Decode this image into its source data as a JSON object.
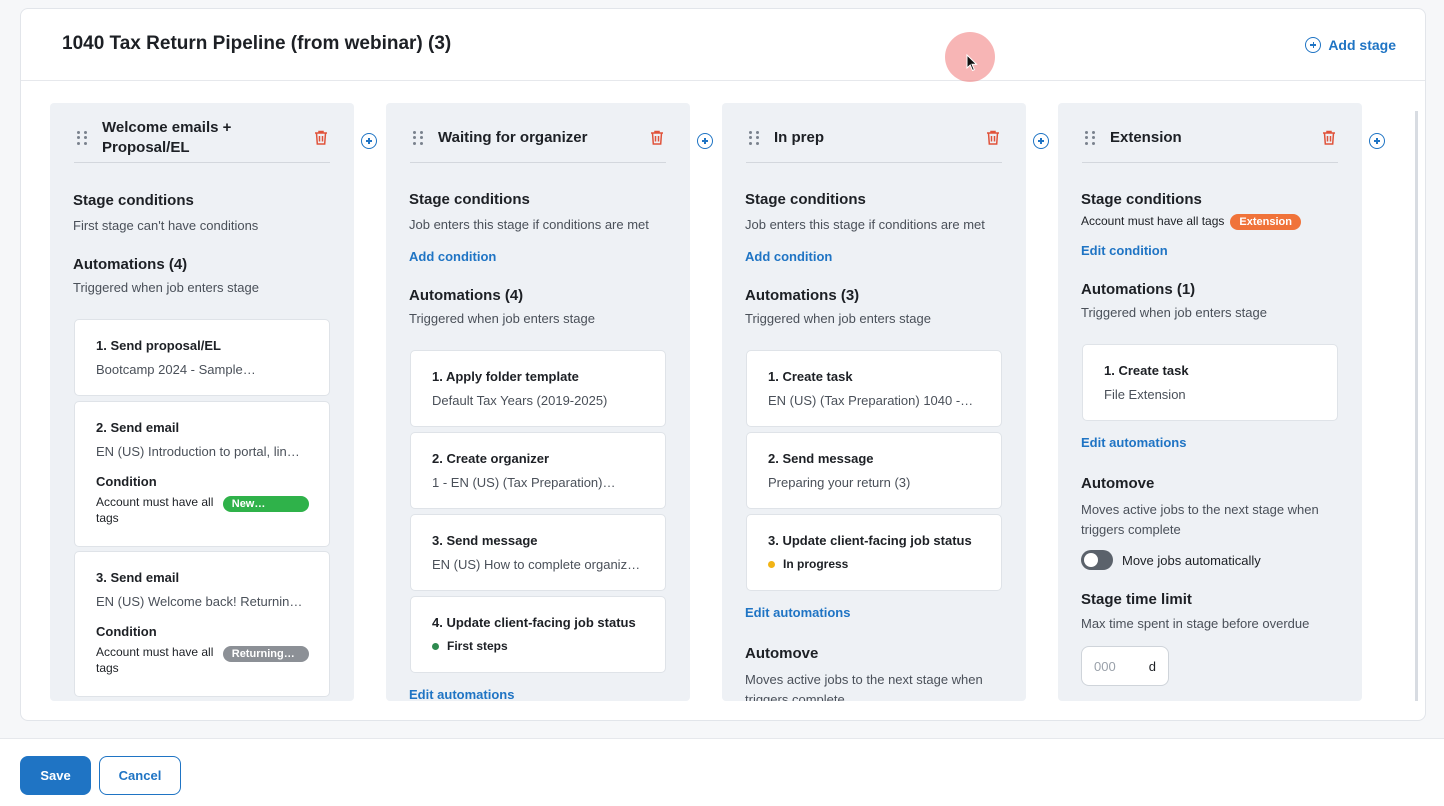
{
  "pipeline": {
    "title": "1040 Tax Return Pipeline (from webinar) (3)",
    "add_stage_label": "Add stage"
  },
  "stages": [
    {
      "name": "Welcome emails + Proposal/EL",
      "conditions_title": "Stage conditions",
      "conditions_sub": "First stage can't have conditions",
      "automations_title": "Automations (4)",
      "automations_sub": "Triggered when job enters stage",
      "cards": [
        {
          "title": "1. Send proposal/EL",
          "sub": "Bootcamp 2024 - Sample…"
        },
        {
          "title": "2. Send email",
          "sub": "EN (US) Introduction to portal, lin…",
          "condition_label": "Condition",
          "condition_text": "Account must have all tags",
          "condition_tag": "New…",
          "condition_tag_color": "#2fb24a"
        },
        {
          "title": "3. Send email",
          "sub": "EN (US) Welcome back! Returning…",
          "condition_label": "Condition",
          "condition_text": "Account must have all tags",
          "condition_tag": "Returning…",
          "condition_tag_color": "#8c9096"
        }
      ]
    },
    {
      "name": "Waiting for organizer",
      "conditions_title": "Stage conditions",
      "conditions_sub": "Job enters this stage if conditions are met",
      "add_condition": "Add condition",
      "automations_title": "Automations (4)",
      "automations_sub": "Triggered when job enters stage",
      "cards": [
        {
          "title": "1. Apply folder template",
          "sub": "Default Tax Years (2019-2025)"
        },
        {
          "title": "2. Create organizer",
          "sub": "1 - EN (US) (Tax Preparation)…"
        },
        {
          "title": "3. Send message",
          "sub": "EN (US) How to complete organize…"
        },
        {
          "title": "4. Update client-facing job status",
          "status": "First steps",
          "status_color": "#2e8a4f"
        }
      ],
      "edit_automations": "Edit automations"
    },
    {
      "name": "In prep",
      "conditions_title": "Stage conditions",
      "conditions_sub": "Job enters this stage if conditions are met",
      "add_condition": "Add condition",
      "automations_title": "Automations (3)",
      "automations_sub": "Triggered when job enters stage",
      "cards": [
        {
          "title": "1. Create task",
          "sub": "EN (US) (Tax Preparation) 1040 -…"
        },
        {
          "title": "2. Send message",
          "sub": "Preparing your return (3)"
        },
        {
          "title": "3. Update client-facing job status",
          "status": "In progress",
          "status_color": "#f2b416"
        }
      ],
      "edit_automations": "Edit automations",
      "automove_title": "Automove",
      "automove_sub": "Moves active jobs to the next stage when triggers complete"
    },
    {
      "name": "Extension",
      "conditions_title": "Stage conditions",
      "conditions_text": "Account must have all tags",
      "conditions_tag": "Extension",
      "edit_condition": "Edit condition",
      "automations_title": "Automations (1)",
      "automations_sub": "Triggered when job enters stage",
      "cards": [
        {
          "title": "1. Create task",
          "sub": "File Extension"
        }
      ],
      "edit_automations": "Edit automations",
      "automove_title": "Automove",
      "automove_sub": "Moves active jobs to the next stage when triggers complete",
      "toggle_label": "Move jobs automatically",
      "toggle_on": false,
      "time_limit_title": "Stage time limit",
      "time_limit_sub": "Max time spent in stage before overdue",
      "time_placeholder": "000",
      "time_unit": "d"
    }
  ],
  "footer": {
    "save_label": "Save",
    "cancel_label": "Cancel"
  },
  "colors": {
    "accent": "#1f74c4",
    "danger": "#e0523a",
    "tag_orange": "#f0733a"
  }
}
